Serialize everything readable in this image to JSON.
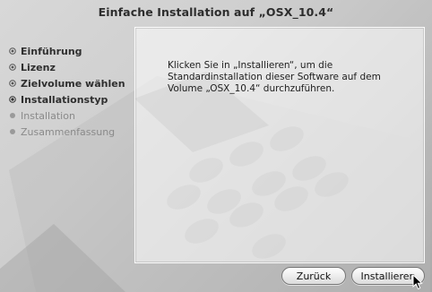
{
  "window": {
    "title": "Einfache Installation auf „OSX_10.4“"
  },
  "sidebar": {
    "steps": [
      {
        "label": "Einführung",
        "state": "done"
      },
      {
        "label": "Lizenz",
        "state": "done"
      },
      {
        "label": "Zielvolume wählen",
        "state": "done"
      },
      {
        "label": "Installationstyp",
        "state": "current"
      },
      {
        "label": "Installation",
        "state": "pending"
      },
      {
        "label": "Zusammenfassung",
        "state": "pending"
      }
    ]
  },
  "main": {
    "message": "Klicken Sie in „Installieren“, um die\nStandardinstallation dieser Software auf dem\nVolume „OSX_10.4“ durchzuführen."
  },
  "buttons": {
    "back_label": "Zurück",
    "install_label": "Installieren"
  },
  "icons": {
    "step_done": "check-circle-icon",
    "step_current": "bullet-icon",
    "step_pending": "gray-bullet-icon",
    "cursor": "arrow-cursor-icon"
  },
  "colors": {
    "text": "#2f2f2f",
    "pending_text": "#8a8a8a"
  }
}
